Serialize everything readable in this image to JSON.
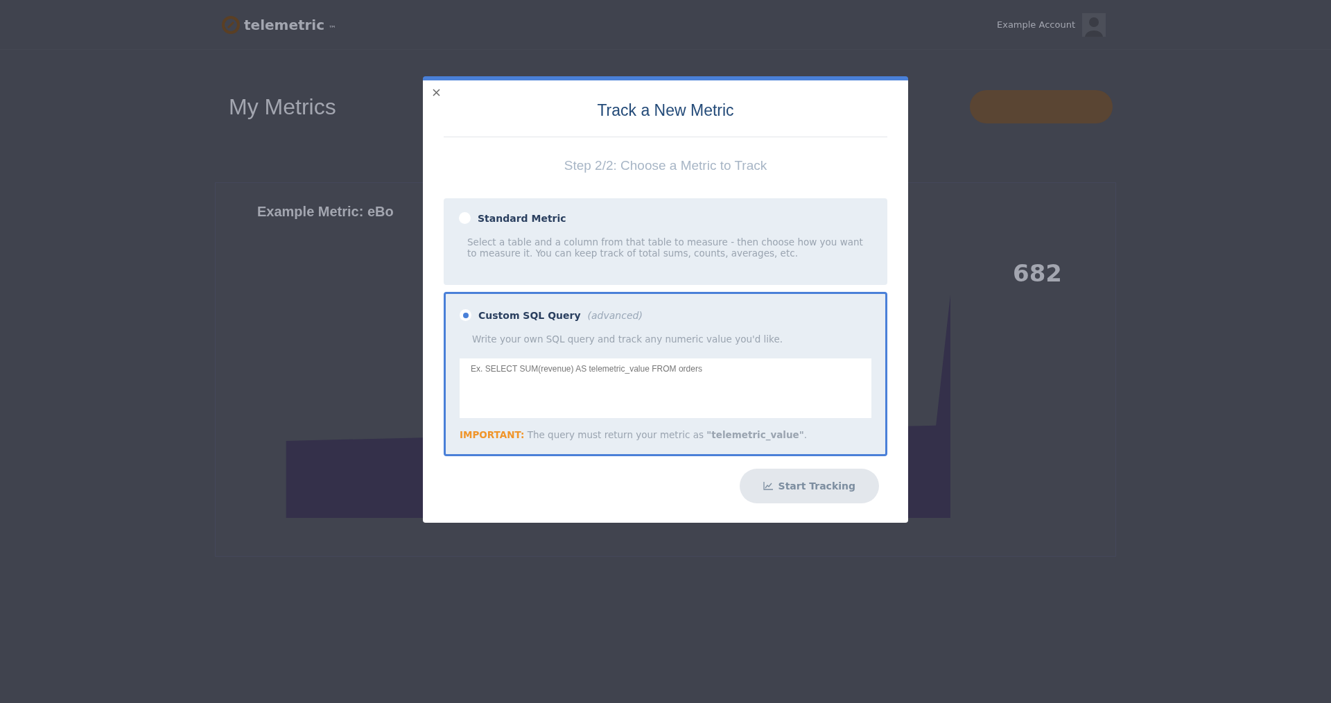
{
  "header": {
    "logo_text": "telemetric",
    "logo_mark": "™",
    "account_name": "Example Account"
  },
  "page": {
    "title": "My Metrics",
    "metric_title": "Example Metric: eBo",
    "stat_value": "682"
  },
  "modal": {
    "title": "Track a New Metric",
    "step": "Step 2/2: Choose a Metric to Track",
    "options": [
      {
        "label": "Standard Metric",
        "selected": false,
        "description": "Select a table and a column from that table to measure - then choose how you want to measure it. You can keep track of total sums, counts, averages, etc."
      },
      {
        "label": "Custom SQL Query",
        "tag": "(advanced)",
        "selected": true,
        "description": "Write your own SQL query and track any numeric value you'd like.",
        "placeholder": "Ex. SELECT SUM(revenue) AS telemetric_value FROM orders",
        "note_label": "IMPORTANT:",
        "note": "The query must return your metric as **\"telemetric_value\"**."
      }
    ],
    "button": {
      "label": "Start Tracking",
      "disabled": true
    }
  }
}
